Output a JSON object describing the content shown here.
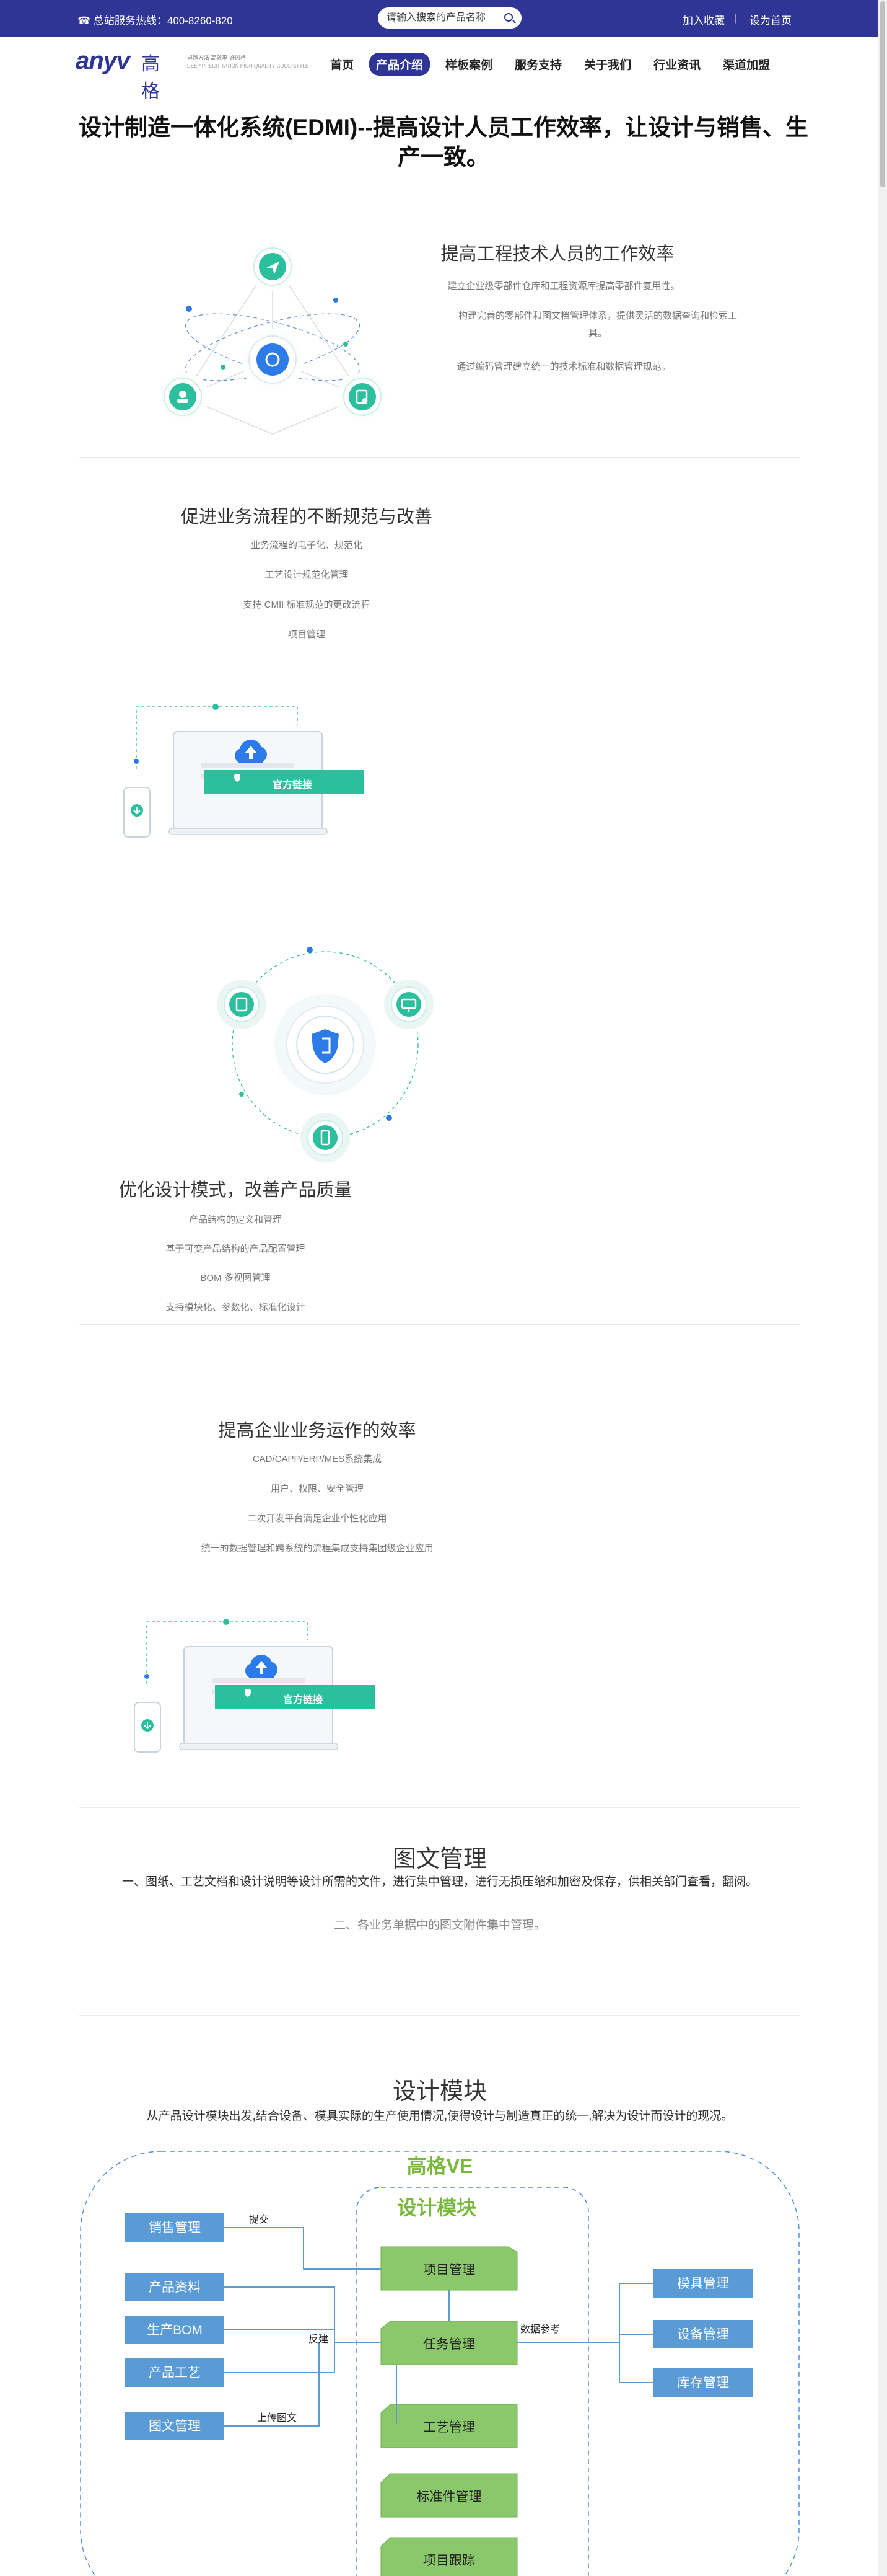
{
  "topbar": {
    "hotline": "☎ 总站服务热线：400-8260-820",
    "search_placeholder": "请输入搜索的产品名称",
    "add_favorite": "加入收藏",
    "separator": "|",
    "set_home": "设为首页"
  },
  "logo": {
    "en": "anyv",
    "cn": "高格",
    "slogan_line1": "卓越方法 高效率 好风格",
    "slogan_line2": "DEEP PRECITITATION HIGH QUALITY GOOD STYLE"
  },
  "nav": [
    "首页",
    "产品介绍",
    "样板案例",
    "服务支持",
    "关于我们",
    "行业资讯",
    "渠道加盟"
  ],
  "nav_active_index": 1,
  "page_title": "设计制造一体化系统(EDMI)--提高设计人员工作效率，让设计与销售、生产一致。",
  "section1": {
    "heading": "提高工程技术人员的工作效率",
    "lines": [
      "建立企业级零部件仓库和工程资源库提高零部件复用性。",
      "构建完善的零部件和图文档管理体系，提供灵活的数据查询和检索工具。",
      "通过编码管理建立统一的技术标准和数据管理规范。"
    ]
  },
  "section2": {
    "heading": "促进业务流程的不断规范与改善",
    "lines": [
      "业务流程的电子化、规范化",
      "工艺设计规范化管理",
      "支持 CMII 标准规范的更改流程",
      "项目管理"
    ],
    "button_label": "官方链接"
  },
  "section3": {
    "heading": "优化设计模式，改善产品质量",
    "lines": [
      "产品结构的定义和管理",
      "基于可变产品结构的产品配置管理",
      "BOM 多视图管理",
      "支持模块化、参数化、标准化设计"
    ]
  },
  "section4": {
    "heading": "提高企业业务运作的效率",
    "lines": [
      "CAD/CAPP/ERP/MES系统集成",
      "用户、权限、安全管理",
      "二次开发平台满足企业个性化应用",
      "统一的数据管理和跨系统的流程集成支持集团级企业应用"
    ],
    "button_label": "官方链接"
  },
  "section5": {
    "heading": "图文管理",
    "line1": "一、图纸、工艺文档和设计说明等设计所需的文件，进行集中管理，进行无损压缩和加密及保存，供相关部门查看，翻阅。",
    "line2": "二、各业务单据中的图文附件集中管理。"
  },
  "section6": {
    "heading": "设计模块",
    "subtitle": "从产品设计模块出发,结合设备、模具实际的生产使用情况,使得设计与制造真正的统一,解决为设计而设计的现况。",
    "diagram": {
      "outer_title": "高格VE",
      "inner_title": "设计模块",
      "left_boxes": [
        "销售管理",
        "产品资料",
        "生产BOM",
        "产品工艺",
        "图文管理"
      ],
      "center_boxes": [
        "项目管理",
        "任务管理",
        "工艺管理",
        "标准件管理",
        "项目跟踪"
      ],
      "right_boxes": [
        "模具管理",
        "设备管理",
        "库存管理"
      ],
      "edge_labels": [
        "提交",
        "反建",
        "上传图文",
        "数据参考"
      ]
    }
  },
  "colors": {
    "brand": "#2e3595",
    "teal": "#2bbf9e",
    "blue_box": "#5b9bd5",
    "green_box": "#8bc86b",
    "green_title": "#7ab83c"
  }
}
